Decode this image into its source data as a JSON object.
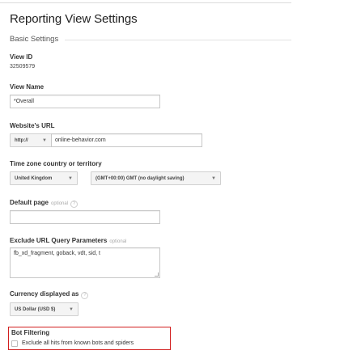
{
  "page": {
    "title": "Reporting View Settings"
  },
  "basic_settings": {
    "label": "Basic Settings"
  },
  "view_id": {
    "label": "View ID",
    "value": "32509579"
  },
  "view_name": {
    "label": "View Name",
    "value": "*Overall"
  },
  "website_url": {
    "label": "Website's URL",
    "protocol": "http://",
    "value": "online-behavior.com"
  },
  "timezone": {
    "label": "Time zone country or territory",
    "country": "United Kingdom",
    "zone": "(GMT+00:00) GMT (no daylight saving)"
  },
  "default_page": {
    "label": "Default page",
    "optional": "optional",
    "value": ""
  },
  "exclude_params": {
    "label": "Exclude URL Query Parameters",
    "optional": "optional",
    "value": "fb_xd_fragment, goback, vdt, sid, t"
  },
  "currency": {
    "label": "Currency displayed as",
    "value": "US Dollar (USD $)"
  },
  "bot_filtering": {
    "label": "Bot Filtering",
    "checkbox_label": "Exclude all hits from known bots and spiders",
    "checked": false,
    "highlight_color": "#d21f1f"
  },
  "icons": {
    "help": "?",
    "caret": "▼"
  }
}
